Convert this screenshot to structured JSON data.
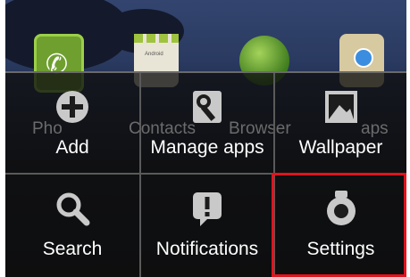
{
  "home_screen": {
    "apps": [
      {
        "label": "Phone",
        "icon": "phone-icon"
      },
      {
        "label": "Contacts",
        "icon": "contacts-icon"
      },
      {
        "label": "Browser",
        "icon": "globe-icon"
      },
      {
        "label": "Maps",
        "icon": "maps-icon"
      }
    ],
    "contacts_icon_text": "Android",
    "visible_label_fragments": [
      "Pho",
      "Contacts",
      "Browser",
      "aps"
    ]
  },
  "options_menu": {
    "items": [
      {
        "label": "Add",
        "icon": "add-icon"
      },
      {
        "label": "Manage apps",
        "icon": "manage-apps-icon"
      },
      {
        "label": "Wallpaper",
        "icon": "wallpaper-icon"
      },
      {
        "label": "Search",
        "icon": "search-icon"
      },
      {
        "label": "Notifications",
        "icon": "notifications-icon"
      },
      {
        "label": "Settings",
        "icon": "settings-icon",
        "highlighted": true
      }
    ]
  },
  "colors": {
    "highlight": "#e0141e",
    "menu_background": "#101010",
    "menu_divider": "#5a5a5a",
    "label_text": "#ffffff",
    "icon_gray": "#c9c9c9"
  }
}
